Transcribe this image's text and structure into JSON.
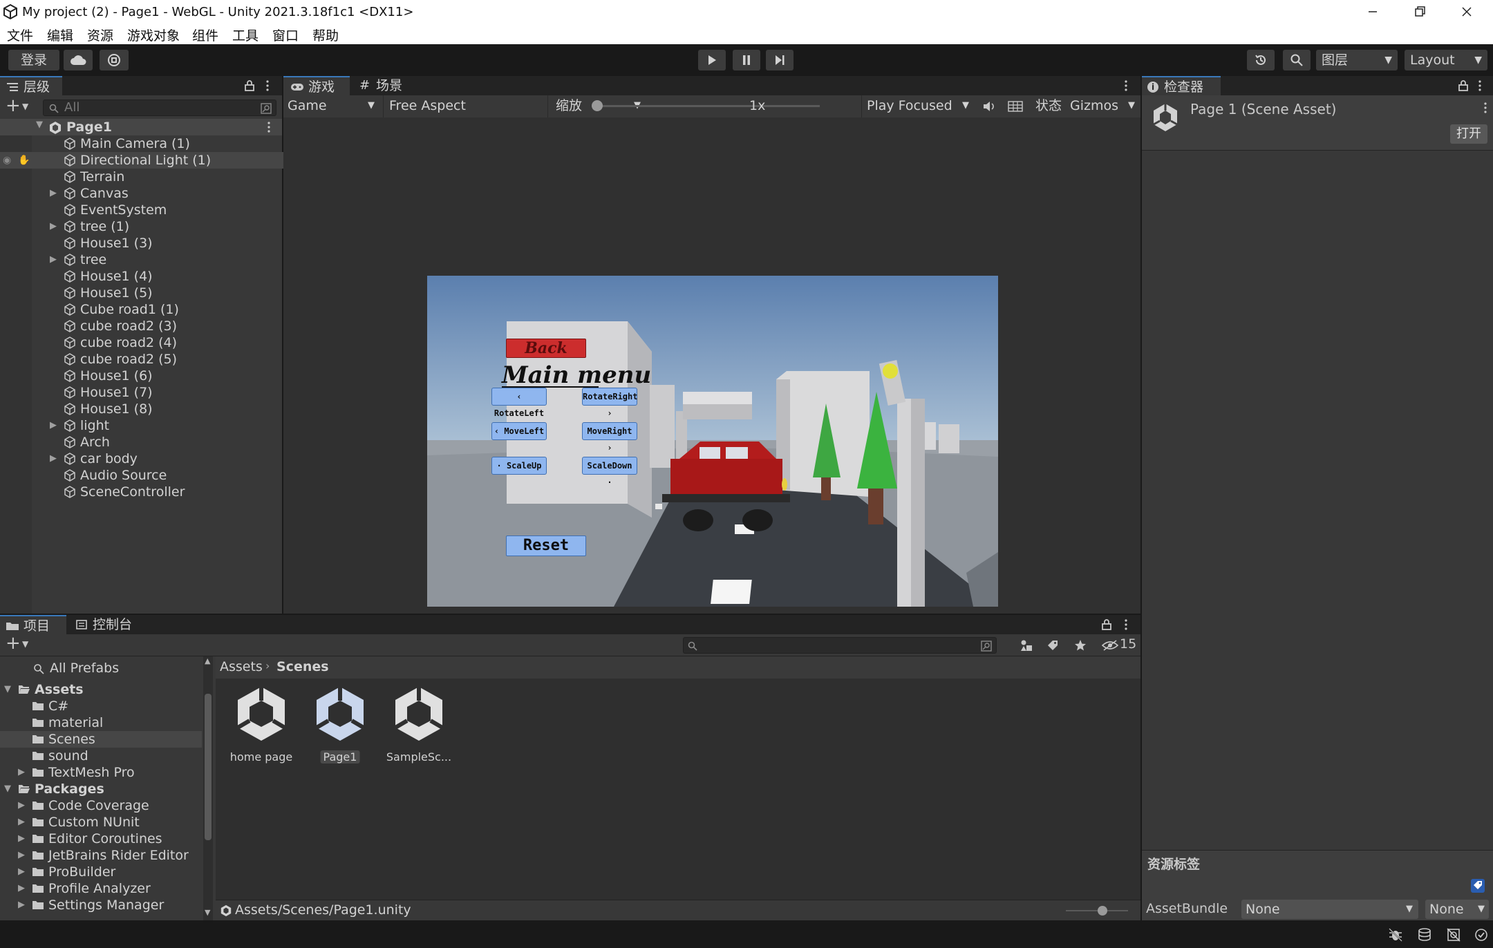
{
  "window": {
    "title": "My project (2) - Page1 - WebGL - Unity 2021.3.18f1c1 <DX11>"
  },
  "menu": [
    "文件",
    "编辑",
    "资源",
    "游戏对象",
    "组件",
    "工具",
    "窗口",
    "帮助"
  ],
  "toolbar": {
    "login": "登录",
    "layers": "图层",
    "layout": "Layout"
  },
  "hierarchy": {
    "tab": "层级",
    "search_placeholder": "All",
    "root": "Page1",
    "items": [
      {
        "label": "Main Camera (1)",
        "expandable": false
      },
      {
        "label": "Directional Light (1)",
        "expandable": false,
        "selected": true
      },
      {
        "label": "Terrain",
        "expandable": false
      },
      {
        "label": "Canvas",
        "expandable": true
      },
      {
        "label": "EventSystem",
        "expandable": false
      },
      {
        "label": "tree (1)",
        "expandable": true
      },
      {
        "label": "House1 (3)",
        "expandable": false
      },
      {
        "label": "tree",
        "expandable": true
      },
      {
        "label": "House1 (4)",
        "expandable": false
      },
      {
        "label": "House1 (5)",
        "expandable": false
      },
      {
        "label": "Cube road1 (1)",
        "expandable": false
      },
      {
        "label": "cube road2 (3)",
        "expandable": false
      },
      {
        "label": "cube road2 (4)",
        "expandable": false
      },
      {
        "label": "cube road2 (5)",
        "expandable": false
      },
      {
        "label": "House1 (6)",
        "expandable": false
      },
      {
        "label": "House1 (7)",
        "expandable": false
      },
      {
        "label": "House1 (8)",
        "expandable": false
      },
      {
        "label": "light",
        "expandable": true
      },
      {
        "label": "Arch",
        "expandable": false
      },
      {
        "label": "car body",
        "expandable": true
      },
      {
        "label": "Audio Source",
        "expandable": false
      },
      {
        "label": "SceneController",
        "expandable": false
      }
    ]
  },
  "game_view": {
    "tab_game": "游戏",
    "tab_scene": "场景",
    "display": "Game",
    "aspect": "Free Aspect",
    "scale_label": "缩放",
    "scale_value": "1x",
    "scale_fraction": 0.0,
    "play_mode": "Play Focused",
    "stats": "状态",
    "gizmos": "Gizmos",
    "ui": {
      "back": "Back",
      "main_menu": "Main menu",
      "rotate_left": "RotateLeft",
      "rotate_right": "RotateRight",
      "move_left": "MoveLeft",
      "move_right": "MoveRight",
      "scale_up": "ScaleUp",
      "scale_down": "ScaleDown",
      "reset": "Reset"
    }
  },
  "inspector": {
    "tab": "检查器",
    "asset_title": "Page 1 (Scene Asset)",
    "open_button": "打开",
    "labels_header": "资源标签",
    "assetbundle_label": "AssetBundle",
    "assetbundle_value": "None",
    "variant_value": "None"
  },
  "project": {
    "tab_project": "项目",
    "tab_console": "控制台",
    "hidden_count": "15",
    "favorites": "All Prefabs",
    "tree": [
      {
        "label": "Assets",
        "level": 0,
        "bold": true,
        "open": true
      },
      {
        "label": "C#",
        "level": 1
      },
      {
        "label": "material",
        "level": 1
      },
      {
        "label": "Scenes",
        "level": 1,
        "selected": true
      },
      {
        "label": "sound",
        "level": 1
      },
      {
        "label": "TextMesh Pro",
        "level": 1,
        "expandable": true
      },
      {
        "label": "Packages",
        "level": 0,
        "bold": true,
        "open": true
      },
      {
        "label": "Code Coverage",
        "level": 1,
        "expandable": true
      },
      {
        "label": "Custom NUnit",
        "level": 1,
        "expandable": true
      },
      {
        "label": "Editor Coroutines",
        "level": 1,
        "expandable": true
      },
      {
        "label": "JetBrains Rider Editor",
        "level": 1,
        "expandable": true
      },
      {
        "label": "ProBuilder",
        "level": 1,
        "expandable": true
      },
      {
        "label": "Profile Analyzer",
        "level": 1,
        "expandable": true
      },
      {
        "label": "Settings Manager",
        "level": 1,
        "expandable": true
      }
    ],
    "breadcrumb": [
      "Assets",
      "Scenes"
    ],
    "assets": [
      {
        "label": "home page"
      },
      {
        "label": "Page1",
        "selected": true
      },
      {
        "label": "SampleSc..."
      }
    ],
    "path": "Assets/Scenes/Page1.unity"
  }
}
